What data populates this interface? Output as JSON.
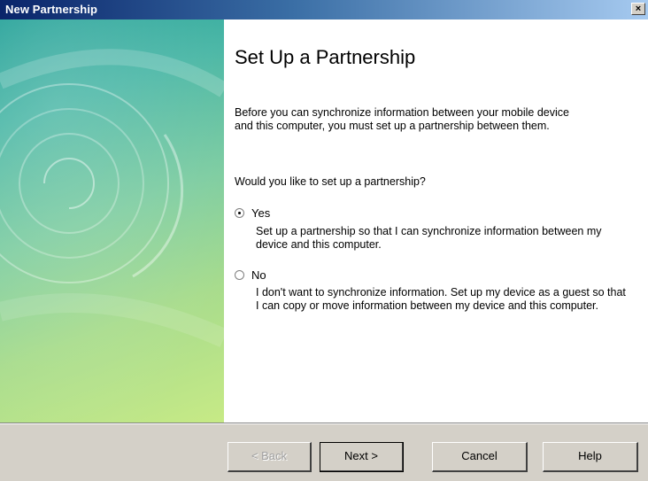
{
  "window": {
    "title": "New Partnership",
    "close_label": "×"
  },
  "page": {
    "heading": "Set Up a Partnership",
    "intro": "Before you can synchronize information between your mobile device and this computer, you must set up a partnership between them.",
    "question": "Would you like to set up a partnership?",
    "options": [
      {
        "label": "Yes",
        "checked": true,
        "description": "Set up a partnership so that I can synchronize information between my device and this computer."
      },
      {
        "label": "No",
        "checked": false,
        "description": "I don't want to synchronize information. Set up my device as a guest so that I can copy or move information between my device and this computer."
      }
    ]
  },
  "buttons": {
    "back": "< Back",
    "next": "Next >",
    "cancel": "Cancel",
    "help": "Help"
  },
  "colors": {
    "title_bar_start": "#0a246a",
    "title_bar_end": "#a6caf0",
    "art_teal": "#1d9e95",
    "art_lime": "#c7ea86",
    "dialog_face": "#d4d0c8"
  }
}
